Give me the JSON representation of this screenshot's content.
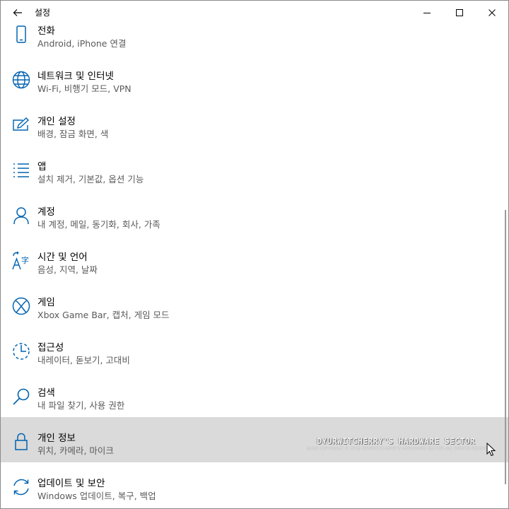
{
  "window": {
    "title": "설정"
  },
  "items": [
    {
      "title": "전화",
      "subtitle": "Android, iPhone 연결",
      "icon": "phone-icon"
    },
    {
      "title": "네트워크 및 인터넷",
      "subtitle": "Wi-Fi, 비행기 모드, VPN",
      "icon": "globe-icon"
    },
    {
      "title": "개인 설정",
      "subtitle": "배경, 잠금 화면, 색",
      "icon": "personalization-icon"
    },
    {
      "title": "앱",
      "subtitle": "설치 제거, 기본값, 옵션 기능",
      "icon": "apps-list-icon"
    },
    {
      "title": "계정",
      "subtitle": "내 계정, 메일, 동기화, 회사, 가족",
      "icon": "person-icon"
    },
    {
      "title": "시간 및 언어",
      "subtitle": "음성, 지역, 날짜",
      "icon": "time-language-icon"
    },
    {
      "title": "게임",
      "subtitle": "Xbox Game Bar, 캡처, 게임 모드",
      "icon": "xbox-icon"
    },
    {
      "title": "접근성",
      "subtitle": "내레이터, 돋보기, 고대비",
      "icon": "accessibility-icon"
    },
    {
      "title": "검색",
      "subtitle": "내 파일 찾기, 사용 권한",
      "icon": "search-icon"
    },
    {
      "title": "개인 정보",
      "subtitle": "위치, 카메라, 마이크",
      "icon": "lock-icon"
    },
    {
      "title": "업데이트 및 보안",
      "subtitle": "Windows 업데이트, 복구, 백업",
      "icon": "update-icon"
    }
  ],
  "hover_index": 9,
  "watermark": {
    "main": "DYURWITCHERRY'S HARDWARE SECTOR",
    "sub": "BLOG COPYRIGHT © 2018 DYURWITCHERRY'S HARDWARE SECTOR ALL RIGHTS RESERVED"
  },
  "colors": {
    "accent": "#0063b1",
    "hover": "#dadada"
  }
}
